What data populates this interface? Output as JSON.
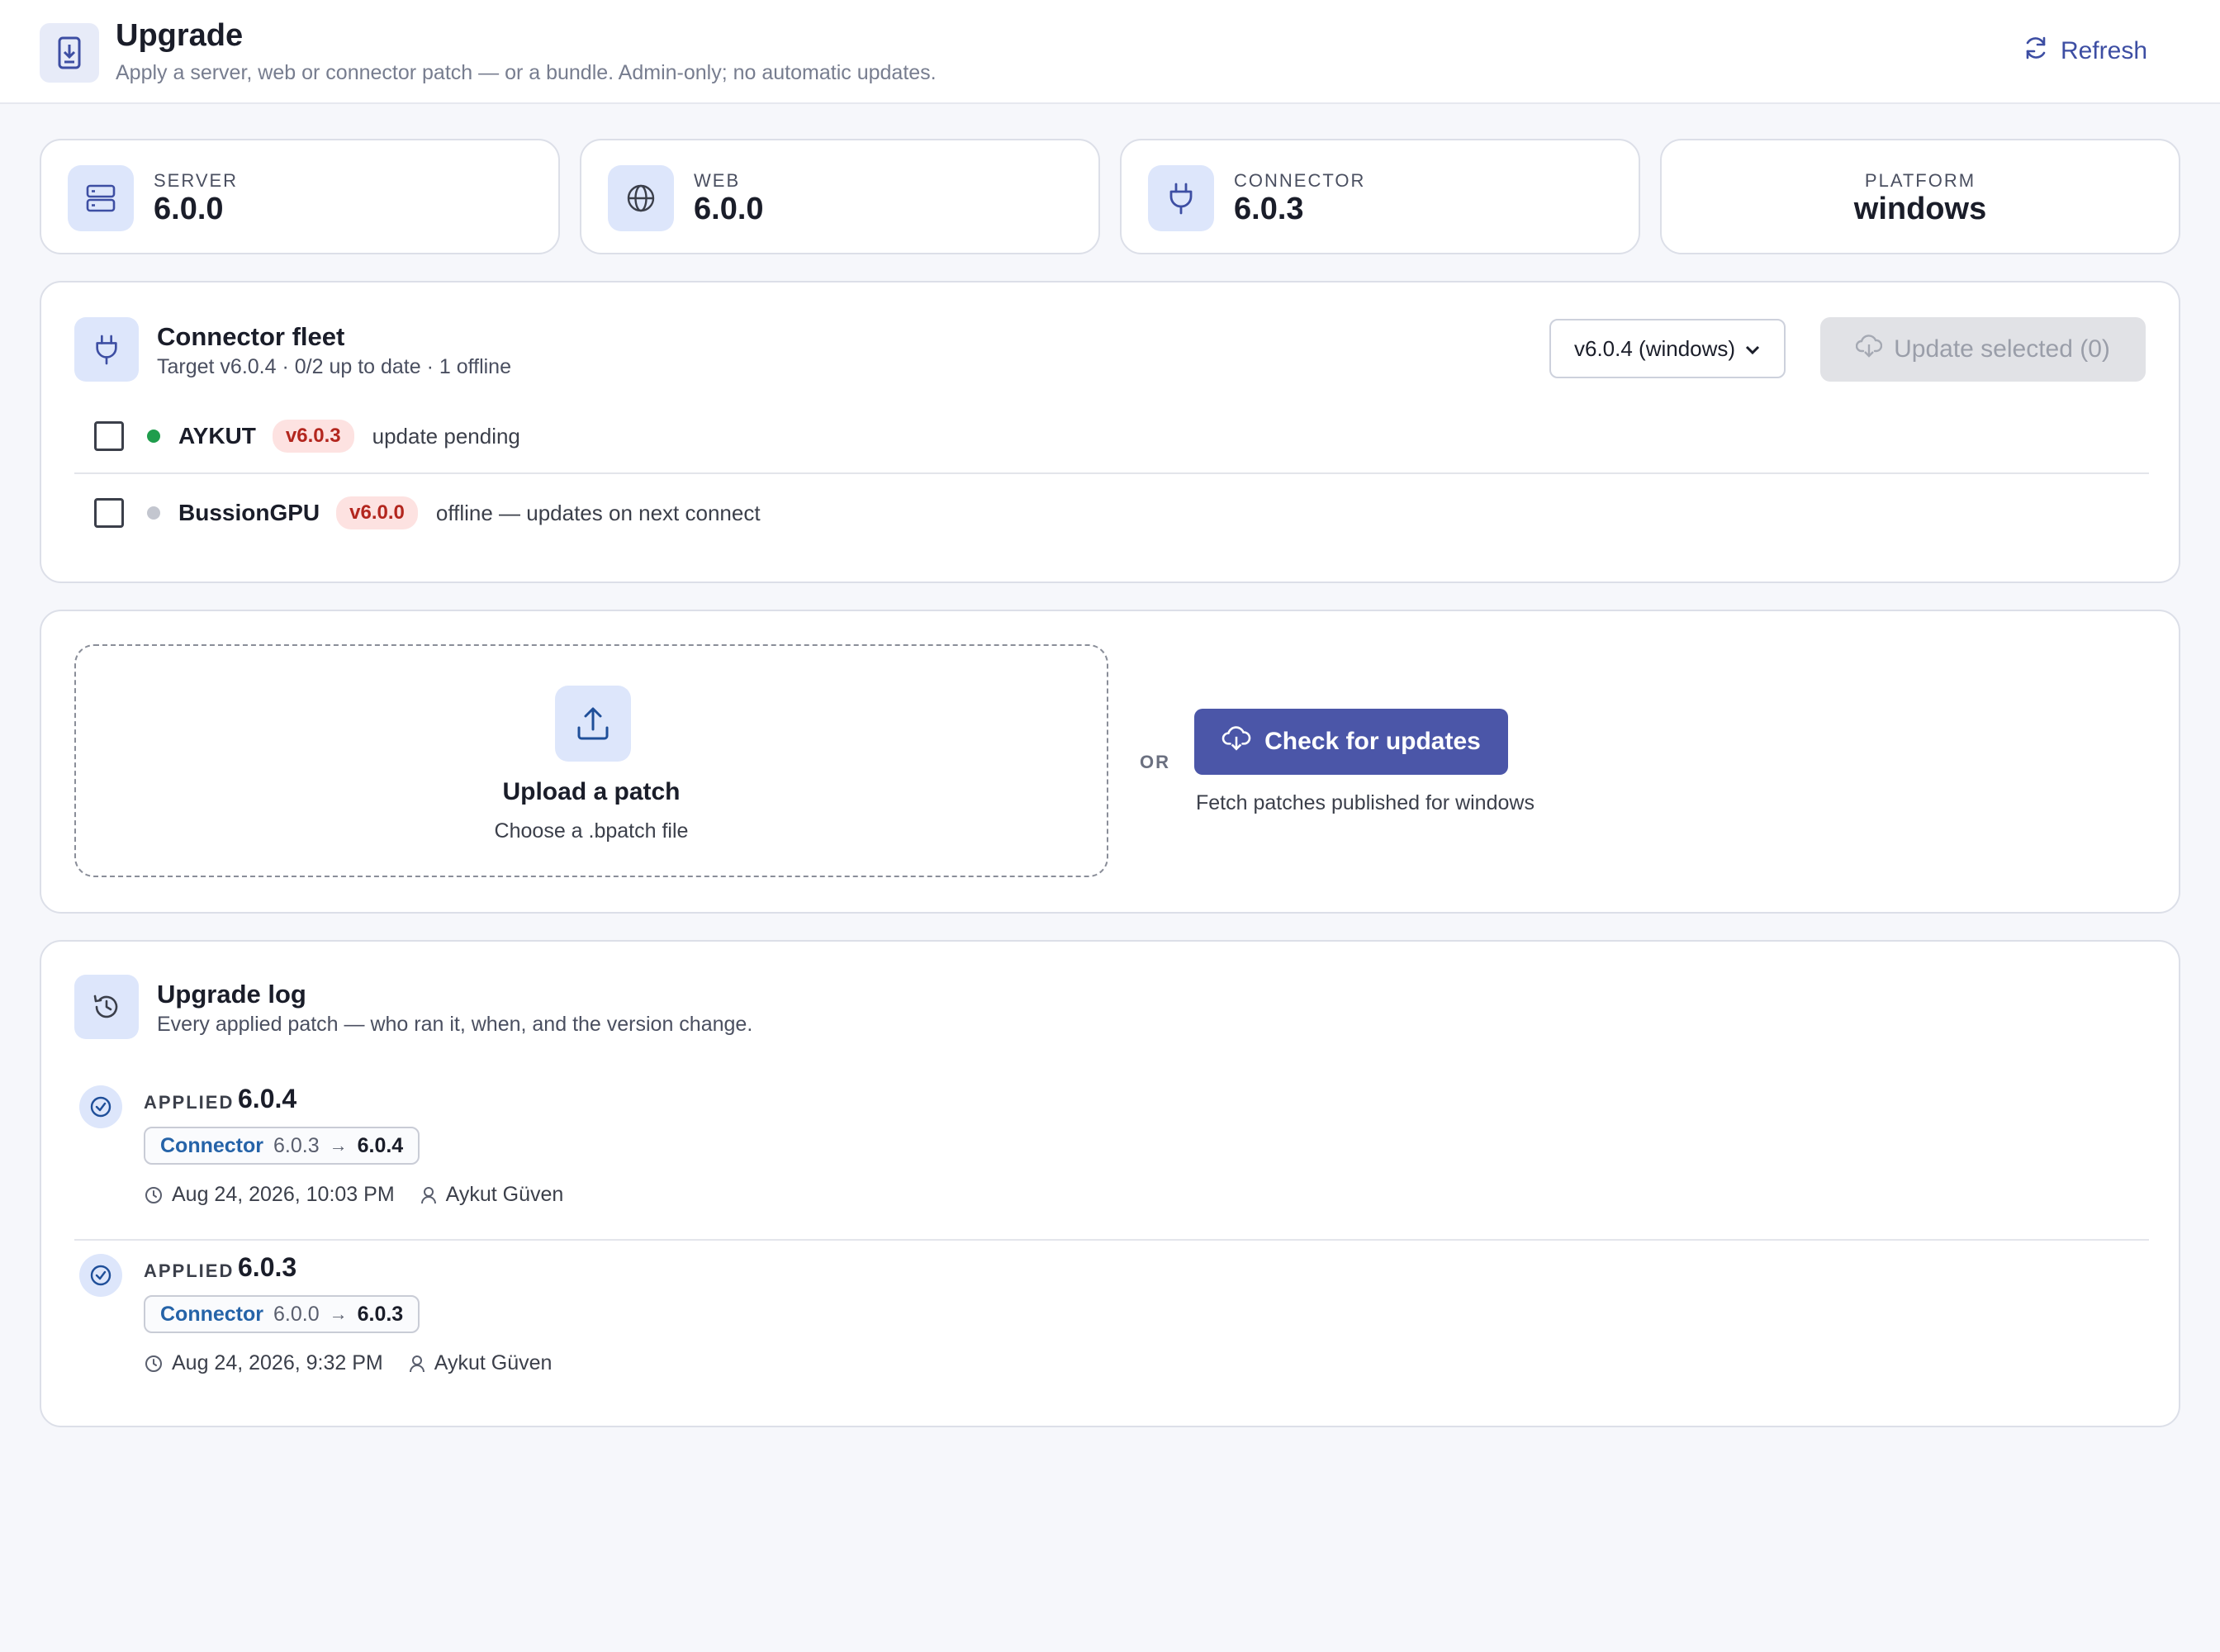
{
  "header": {
    "title": "Upgrade",
    "subtitle": "Apply a server, web or connector patch — or a bundle. Admin-only; no automatic updates.",
    "refresh_label": "Refresh",
    "icon": "phone-download-icon"
  },
  "stats": [
    {
      "label": "SERVER",
      "value": "6.0.0",
      "icon": "server-icon"
    },
    {
      "label": "WEB",
      "value": "6.0.0",
      "icon": "globe-icon"
    },
    {
      "label": "CONNECTOR",
      "value": "6.0.3",
      "icon": "plug-icon"
    },
    {
      "label": "PLATFORM",
      "value": "windows"
    }
  ],
  "fleet": {
    "title": "Connector fleet",
    "subtitle": "Target v6.0.4 · 0/2 up to date · 1 offline",
    "selected_version": "v6.0.4 (windows)",
    "update_label": "Update selected (0)",
    "rows": [
      {
        "name": "AYKUT",
        "version": "v6.0.3",
        "status": "update pending",
        "online": true,
        "checked": false
      },
      {
        "name": "BussionGPU",
        "version": "v6.0.0",
        "status": "offline — updates on next connect",
        "online": false,
        "checked": false
      }
    ]
  },
  "upload": {
    "title": "Upload a patch",
    "subtitle": "Choose a .bpatch file",
    "or_label": "OR",
    "check_label": "Check for updates",
    "check_hint": "Fetch patches published for windows"
  },
  "log": {
    "title": "Upgrade log",
    "subtitle": "Every applied patch — who ran it, when, and the version change.",
    "entries": [
      {
        "status": "APPLIED",
        "version": "6.0.4",
        "component": "Connector",
        "from": "6.0.3",
        "to": "6.0.4",
        "date": "Aug 24, 2026, 10:03 PM",
        "user": "Aykut Güven"
      },
      {
        "status": "APPLIED",
        "version": "6.0.3",
        "component": "Connector",
        "from": "6.0.0",
        "to": "6.0.3",
        "date": "Aug 24, 2026, 9:32 PM",
        "user": "Aykut Güven"
      }
    ]
  },
  "colors": {
    "accent": "#4b56a8",
    "online": "#1f9d4c",
    "offline": "#c3c6cf",
    "badge_bg": "#fde2e1",
    "badge_text": "#b3261e"
  }
}
